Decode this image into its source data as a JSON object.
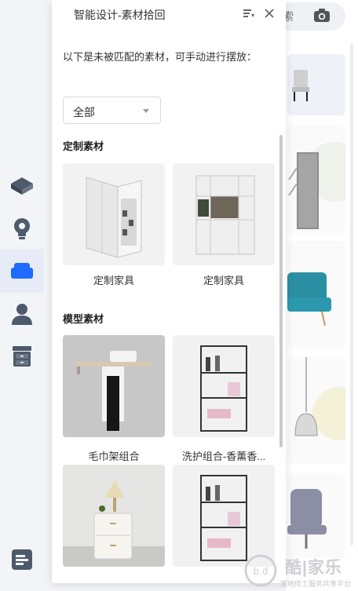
{
  "panel": {
    "title": "智能设计-素材拾回",
    "intro": "以下是未被匹配的素材，可手动进行摆放：",
    "filter": {
      "selected": "全部"
    },
    "sections": [
      {
        "title": "定制素材",
        "items": [
          {
            "label": "定制家具"
          },
          {
            "label": "定制家具"
          }
        ]
      },
      {
        "title": "模型素材",
        "items": [
          {
            "label": "毛巾架组合"
          },
          {
            "label": "洗护组合-香薰香..."
          },
          {
            "label": ""
          },
          {
            "label": ""
          }
        ]
      }
    ]
  },
  "background": {
    "search_char": "索"
  },
  "rail": {
    "items": [
      {
        "icon": "cube-stack-icon"
      },
      {
        "icon": "lightbulb-icon"
      },
      {
        "icon": "sofa-icon",
        "active": true
      },
      {
        "icon": "user-icon"
      },
      {
        "icon": "cabinet-icon"
      },
      {
        "icon": "collapse-icon"
      }
    ]
  },
  "watermark": {
    "text": "酷|家乐",
    "sub": "富地修工服务共享平台"
  },
  "colors": {
    "accent": "#1f6bff",
    "rail_active_bg": "#e6ebf5",
    "panel_bg": "#ffffff"
  }
}
